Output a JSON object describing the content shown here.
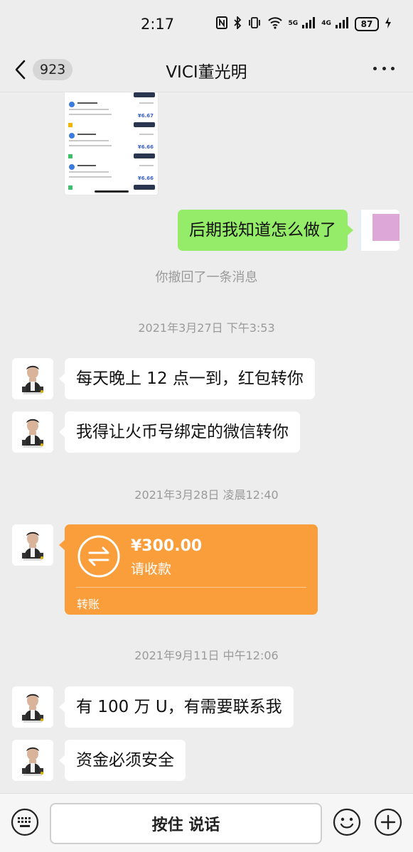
{
  "status_bar": {
    "time": "2:17",
    "icons": [
      "nfc-icon",
      "bluetooth-icon",
      "vibrate-icon",
      "wifi-icon",
      "5g-signal-icon",
      "4g-signal-icon"
    ],
    "net_5g": "5G",
    "net_4g": "4G",
    "battery": "87"
  },
  "header": {
    "unread_count": "923",
    "title": "VICI董光明"
  },
  "messages": {
    "outgoing_text": "后期我知道怎么做了",
    "recalled_notice": "你撤回了一条消息",
    "timestamp_1": "2021年3月27日 下午3:53",
    "incoming_1": "每天晚上 12 点一到，红包转你",
    "incoming_2": "我得让火币号绑定的微信转你",
    "timestamp_2": "2021年3月28日 凌晨12:40",
    "transfer": {
      "amount": "¥300.00",
      "status": "请收款",
      "label": "转账"
    },
    "timestamp_3": "2021年9月11日 中午12:06",
    "incoming_3": "有 100 万 U，有需要联系我",
    "incoming_4": "资金必须安全"
  },
  "input_bar": {
    "hold_to_talk": "按住 说话"
  },
  "colors": {
    "background": "#ededed",
    "outgoing_bubble": "#95ec69",
    "incoming_bubble": "#ffffff",
    "transfer_card": "#fa9d3b",
    "system_text": "#9a9a9a"
  }
}
